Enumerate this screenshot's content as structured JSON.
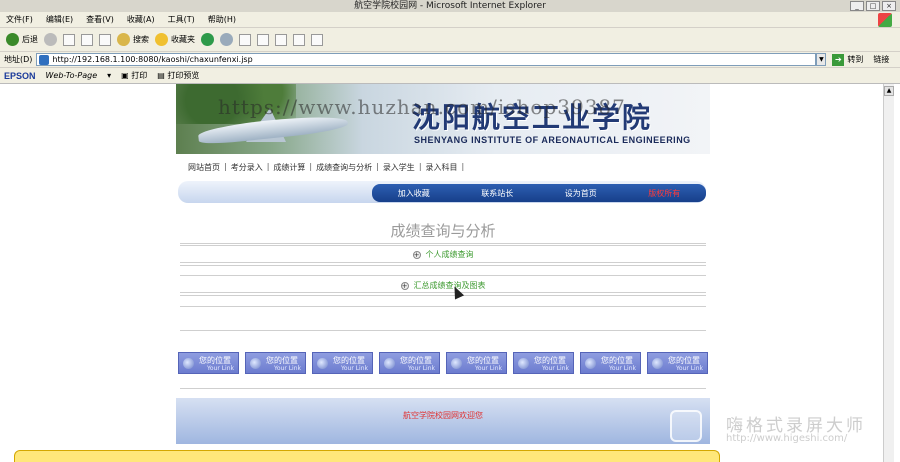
{
  "window": {
    "title": "航空学院校园网 - Microsoft Internet Explorer",
    "controls": [
      "_",
      "□",
      "×"
    ]
  },
  "menu": [
    "文件(F)",
    "编辑(E)",
    "查看(V)",
    "收藏(A)",
    "工具(T)",
    "帮助(H)"
  ],
  "toolbar": {
    "back": "后退",
    "search": "搜索",
    "favorites": "收藏夹"
  },
  "address": {
    "label": "地址(D)",
    "url": "http://192.168.1.100:8080/kaoshi/chaxunfenxi.jsp",
    "go": "转到",
    "links": "链接"
  },
  "epson": {
    "brand": "EPSON",
    "web_to_page": "Web-To-Page",
    "print": "打印",
    "print_preview": "打印预览"
  },
  "site": {
    "school_cn": "沈阳航空工业学院",
    "school_en": "SHENYANG INSTITUTE OF AREONAUTICAL ENGINEERING",
    "watermark": "https://www.huzhan.com/ishop39387",
    "nav": [
      "网站首页",
      "考分录入",
      "成绩计算",
      "成绩查询与分析",
      "录入学生",
      "录入科目"
    ],
    "tabs": [
      "加入收藏",
      "联系站长",
      "设为首页",
      "版权所有"
    ],
    "content_title": "成绩查询与分析",
    "link1": "个人成绩查询",
    "link2": "汇总成绩查询及图表",
    "loc_label": "您的位置",
    "loc_sub": "Your Link",
    "footer": "航空学院校园网欢迎您"
  },
  "recorder": {
    "name": "嗨格式录屏大师",
    "url": "http://www.higeshi.com/"
  }
}
